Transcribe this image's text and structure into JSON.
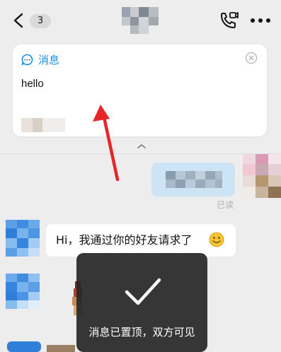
{
  "topbar": {
    "unread_count": "3"
  },
  "pinned": {
    "header_label": "消息",
    "message_text": "hello"
  },
  "chat": {
    "read_receipt": "已读",
    "incoming_text": "Hi，我通过你的好友请求了"
  },
  "toast": {
    "text": "消息已置顶，双方可见"
  },
  "colors": {
    "background": "#ededed",
    "accent_blue": "#1d8fe0",
    "outgoing_bubble": "#cde4f7",
    "annotation_red": "#e8262a",
    "toast_bg": "#262626"
  },
  "icons": [
    "back-chevron-icon",
    "phone-call-icon",
    "more-dots-icon",
    "chat-bubble-icon",
    "close-icon",
    "collapse-chevron-icon",
    "checkmark-icon",
    "smile-emoji-icon"
  ]
}
